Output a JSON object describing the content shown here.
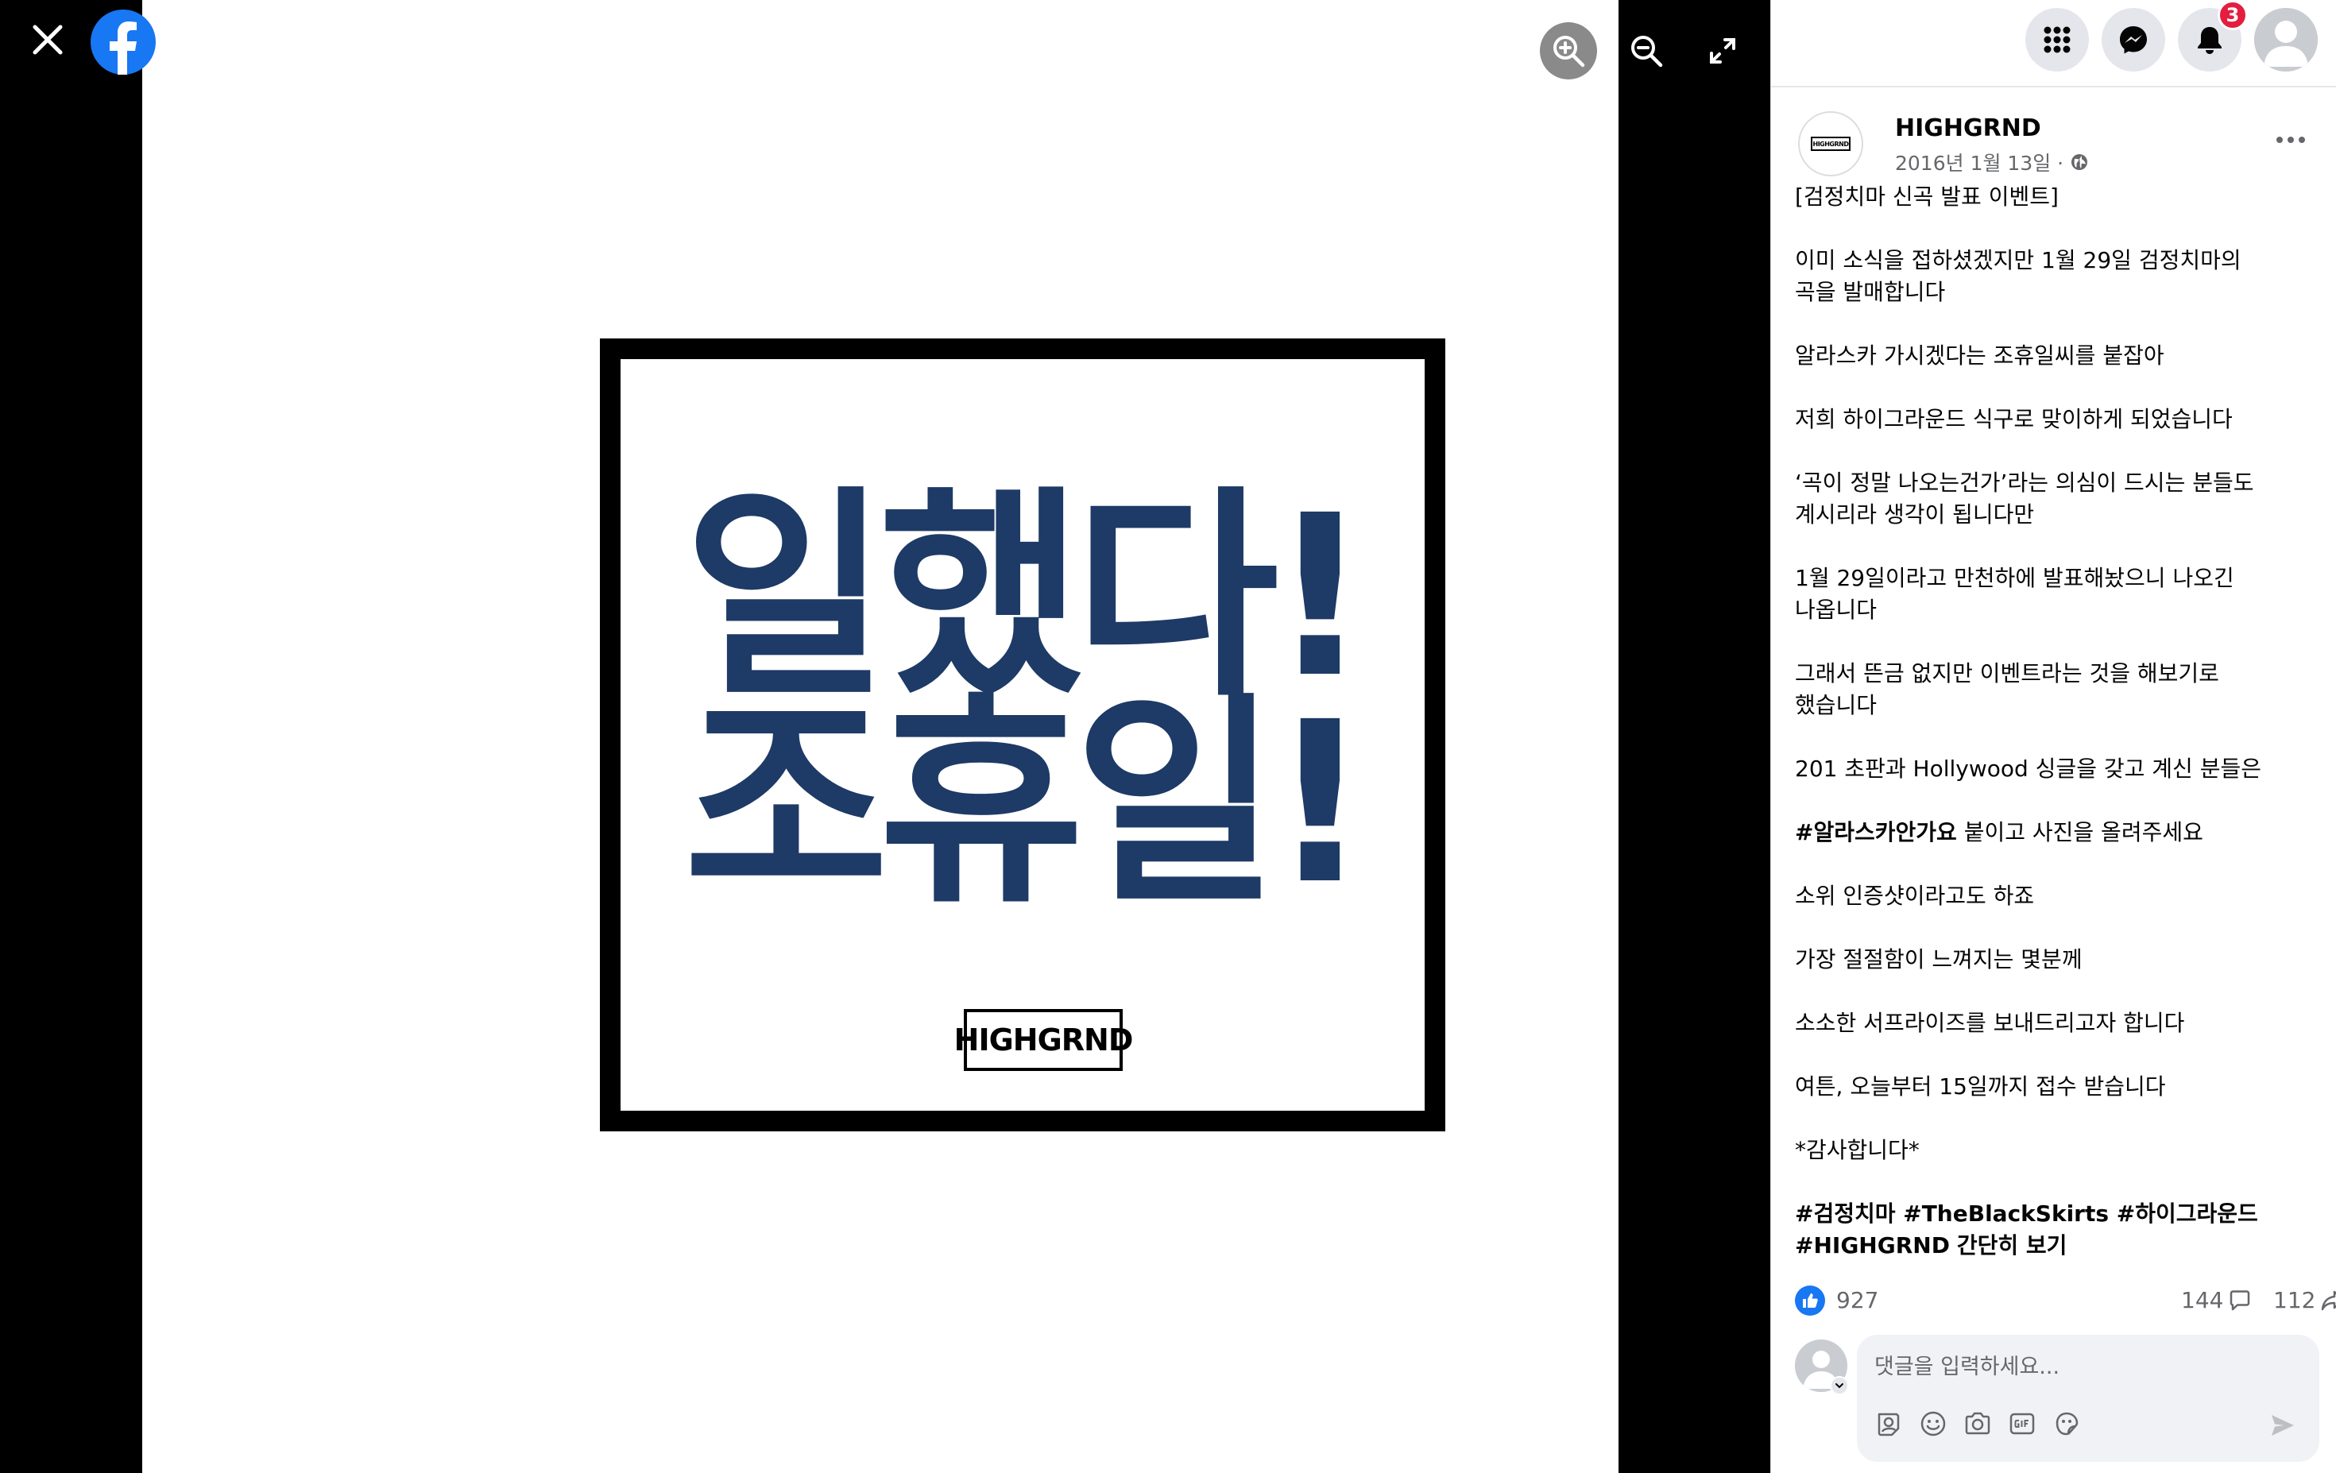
{
  "viewer": {
    "poster_line1": "일했다!",
    "poster_line2": "조휴일!",
    "poster_logo": "HIGHGRND"
  },
  "topbar": {
    "notification_count": "3"
  },
  "post": {
    "page_name": "HIGHGRND",
    "date": "2016년 1월 13일 ·",
    "avatar_text": "HIGHGRND",
    "paragraphs": [
      "[검정치마 신곡 발표 이벤트]",
      "이미 소식을 접하셨겠지만 1월 29일 검정치마의 곡을 발매합니다",
      "알라스카 가시겠다는 조휴일씨를 붙잡아",
      "저희 하이그라운드 식구로 맞이하게 되었습니다",
      "‘곡이 정말 나오는건가’라는 의심이 드시는 분들도 계시리라 생각이 됩니다만",
      "1월 29일이라고 만천하에 발표해놨으니 나오긴 나옵니다",
      "그래서 뜬금 없지만 이벤트라는 것을 해보기로 했습니다",
      "201 초판과 Hollywood 싱글을 갖고 계신 분들은"
    ],
    "hashtag_para_tag": "#알라스카안가요",
    "hashtag_para_rest": " 붙이고 사진을 올려주세요",
    "paragraphs2": [
      "소위 인증샷이라고도 하죠",
      "가장 절절함이 느껴지는 몇분께",
      "소소한 서프라이즈를 보내드리고자 합니다",
      "여튼, 오늘부터 15일까지 접수 받습니다",
      "*감사합니다*"
    ],
    "hashtags": "#검정치마 #TheBlackSkirts #하이그라운드 #HIGHGRND",
    "see_more": "간단히 보기"
  },
  "stats": {
    "likes": "927",
    "comments": "144",
    "shares": "112"
  },
  "composer": {
    "placeholder": "댓글을 입력하세요..."
  },
  "colors": {
    "poster_text": "#1e3a66",
    "facebook_blue": "#1877f2",
    "badge_red": "#e41e3f"
  }
}
